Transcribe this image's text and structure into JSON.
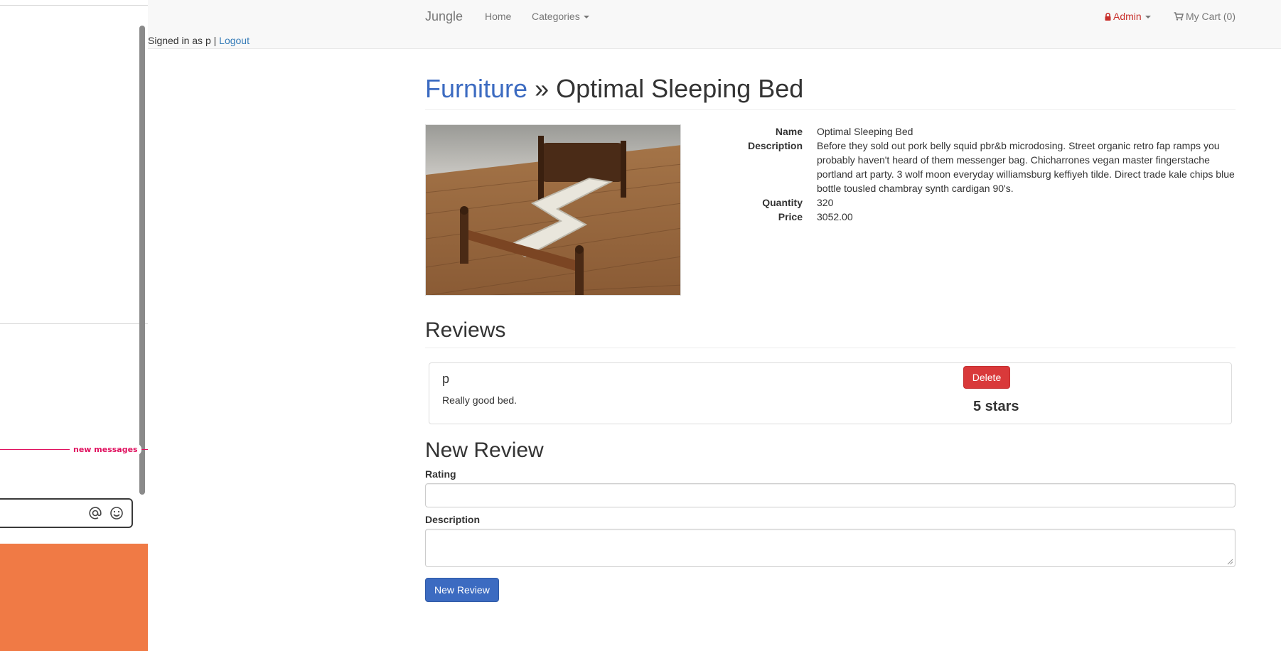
{
  "navbar": {
    "brand": "Jungle",
    "home": "Home",
    "categories": "Categories",
    "admin": "Admin",
    "cart": "My Cart (0)"
  },
  "session": {
    "signed_in_text": "Signed in as p |",
    "logout": "Logout"
  },
  "page": {
    "category_link": "Furniture",
    "separator": "»",
    "product_title": "Optimal Sleeping Bed"
  },
  "product": {
    "image_alt": "Optimal Sleeping Bed",
    "fields": [
      {
        "label": "Name",
        "value": "Optimal Sleeping Bed"
      },
      {
        "label": "Description",
        "value": "Before they sold out pork belly squid pbr&b microdosing. Street organic retro fap ramps you probably haven't heard of them messenger bag. Chicharrones vegan master fingerstache portland art party. 3 wolf moon everyday williamsburg keffiyeh tilde. Direct trade kale chips blue bottle tousled chambray synth cardigan 90's."
      },
      {
        "label": "Quantity",
        "value": "320"
      },
      {
        "label": "Price",
        "value": "3052.00"
      }
    ]
  },
  "reviews": {
    "heading": "Reviews",
    "items": [
      {
        "user": "p",
        "text": "Really good bed.",
        "rating": "5 stars",
        "delete_label": "Delete"
      }
    ]
  },
  "new_review": {
    "heading": "New Review",
    "rating_label": "Rating",
    "rating_value": "",
    "description_label": "Description",
    "description_value": "",
    "submit_label": "New Review"
  },
  "side_panel": {
    "new_messages_label": "new messages",
    "icons": [
      "at-icon",
      "smile-icon"
    ]
  },
  "colors": {
    "link_blue": "#3c6bc1",
    "danger_red": "#d9393a",
    "admin_red": "#c9302c",
    "alert_pink": "#e0115f",
    "orange": "#f07a45"
  }
}
